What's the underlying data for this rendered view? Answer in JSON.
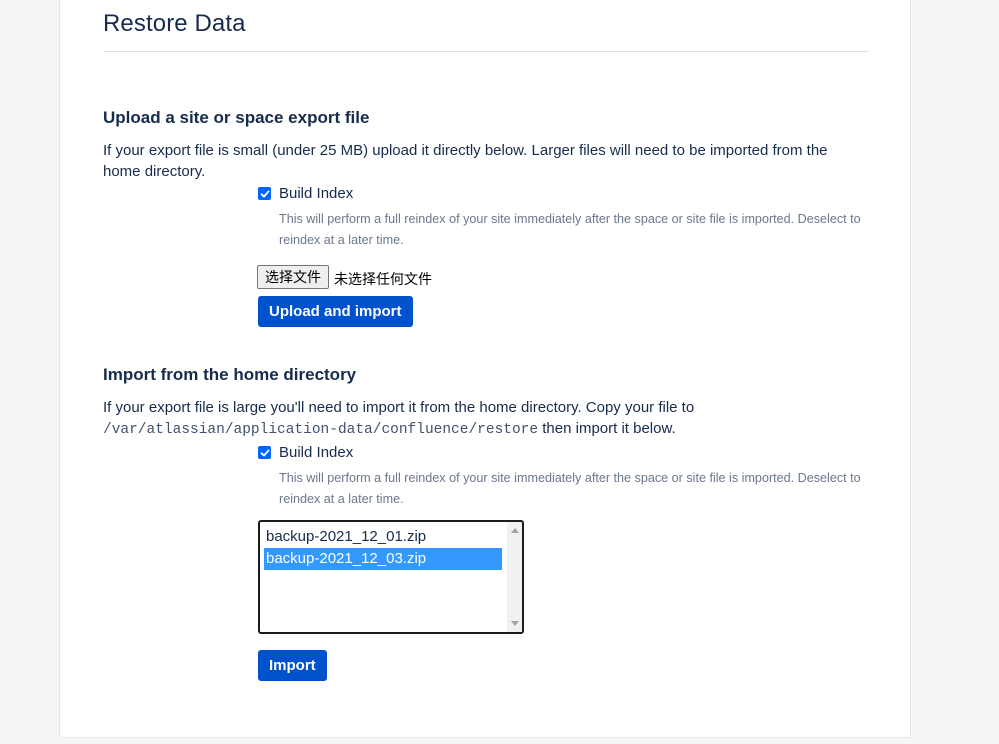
{
  "page": {
    "title": "Restore Data"
  },
  "upload_section": {
    "heading": "Upload a site or space export file",
    "description": "If your export file is small (under 25 MB) upload it directly below. Larger files will need to be imported from the home directory.",
    "build_index": {
      "checked": true,
      "label": "Build Index",
      "help": "This will perform a full reindex of your site immediately after the space or site file is imported. Deselect to reindex at a later time."
    },
    "file_input": {
      "button_label": "选择文件",
      "status": "未选择任何文件"
    },
    "submit_label": "Upload and import"
  },
  "home_section": {
    "heading": "Import from the home directory",
    "description_before": "If your export file is large you'll need to import it from the home directory. Copy your file to",
    "path": "/var/atlassian/application-data/confluence/restore",
    "description_after": "then import it below.",
    "build_index": {
      "checked": true,
      "label": "Build Index",
      "help": "This will perform a full reindex of your site immediately after the space or site file is imported. Deselect to reindex at a later time."
    },
    "files": [
      {
        "name": "backup-2021_12_01.zip",
        "selected": false
      },
      {
        "name": "backup-2021_12_03.zip",
        "selected": true
      }
    ],
    "submit_label": "Import"
  },
  "colors": {
    "primary": "#0052cc",
    "checkbox": "#0065ff",
    "selection": "#3399ff",
    "text": "#172b4d",
    "muted": "#6b778c"
  }
}
